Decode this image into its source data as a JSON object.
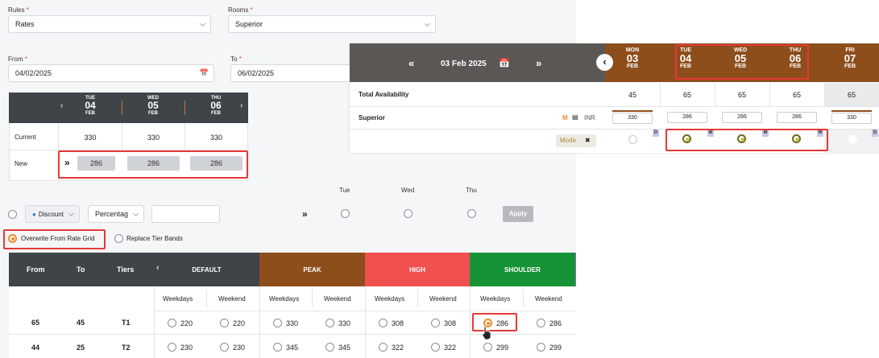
{
  "form": {
    "rules_label": "Rules",
    "rules_value": "Rates",
    "rooms_label": "Rooms",
    "rooms_value": "Superior",
    "from_label": "From",
    "from_value": "04/02/2025",
    "to_label": "To",
    "to_value": "06/02/2025",
    "required_mark": "*"
  },
  "mini_grid": {
    "days": [
      {
        "dow": "TUE",
        "num": "04",
        "month": "FEB"
      },
      {
        "dow": "WED",
        "num": "05",
        "month": "FEB"
      },
      {
        "dow": "THU",
        "num": "06",
        "month": "FEB"
      }
    ],
    "current_label": "Current",
    "current_values": [
      "330",
      "330",
      "330"
    ],
    "new_label": "New",
    "new_values": [
      "286",
      "286",
      "286"
    ]
  },
  "options": {
    "discount_label": "Discount",
    "percentage_label": "Percentag",
    "day_labels": [
      "Tue",
      "Wed",
      "Thu"
    ],
    "apply_label": "Apply",
    "overwrite_label": "Overwrite From Rate Grid",
    "replace_label": "Replace Tier Bands"
  },
  "rate_grid": {
    "headers": {
      "from": "From",
      "to": "To",
      "tiers": "Tiers"
    },
    "bands": [
      {
        "name": "DEFAULT",
        "color": "#3f4448"
      },
      {
        "name": "PEAK",
        "color": "#8e4e1c"
      },
      {
        "name": "HIGH",
        "color": "#f0504e"
      },
      {
        "name": "SHOULDER",
        "color": "#179337"
      }
    ],
    "sub_weekdays": "Weekdays",
    "sub_weekend": "Weekend",
    "rows": [
      {
        "from": "65",
        "to": "45",
        "tier": "T1",
        "values": [
          "220",
          "220",
          "330",
          "330",
          "308",
          "308",
          "286",
          "286"
        ]
      },
      {
        "from": "44",
        "to": "25",
        "tier": "T2",
        "values": [
          "230",
          "230",
          "345",
          "345",
          "322",
          "322",
          "299",
          "299"
        ]
      }
    ],
    "selected_cell": "286"
  },
  "calendar": {
    "title": "03 Feb 2025",
    "days": [
      {
        "dow": "MON",
        "num": "03",
        "month": "FEB"
      },
      {
        "dow": "TUE",
        "num": "04",
        "month": "FEB"
      },
      {
        "dow": "WED",
        "num": "05",
        "month": "FEB"
      },
      {
        "dow": "THU",
        "num": "06",
        "month": "FEB"
      },
      {
        "dow": "FRI",
        "num": "07",
        "month": "FEB"
      }
    ],
    "total_label": "Total Availability",
    "total_values": [
      "45",
      "65",
      "65",
      "65",
      "65"
    ],
    "room_label": "Superior",
    "m_badge": "M",
    "currency": "INR",
    "rate_values": [
      "330",
      "286",
      "286",
      "286",
      "330"
    ],
    "mode_label": "Mode",
    "mode_close": "✖",
    "tag_d": "D",
    "tag_m": "M"
  },
  "colors": {
    "accent_orange": "#f08c2c",
    "brand_brown": "#8e4e1c",
    "header_dark": "#3f4448",
    "highlight_red": "#e53935"
  }
}
